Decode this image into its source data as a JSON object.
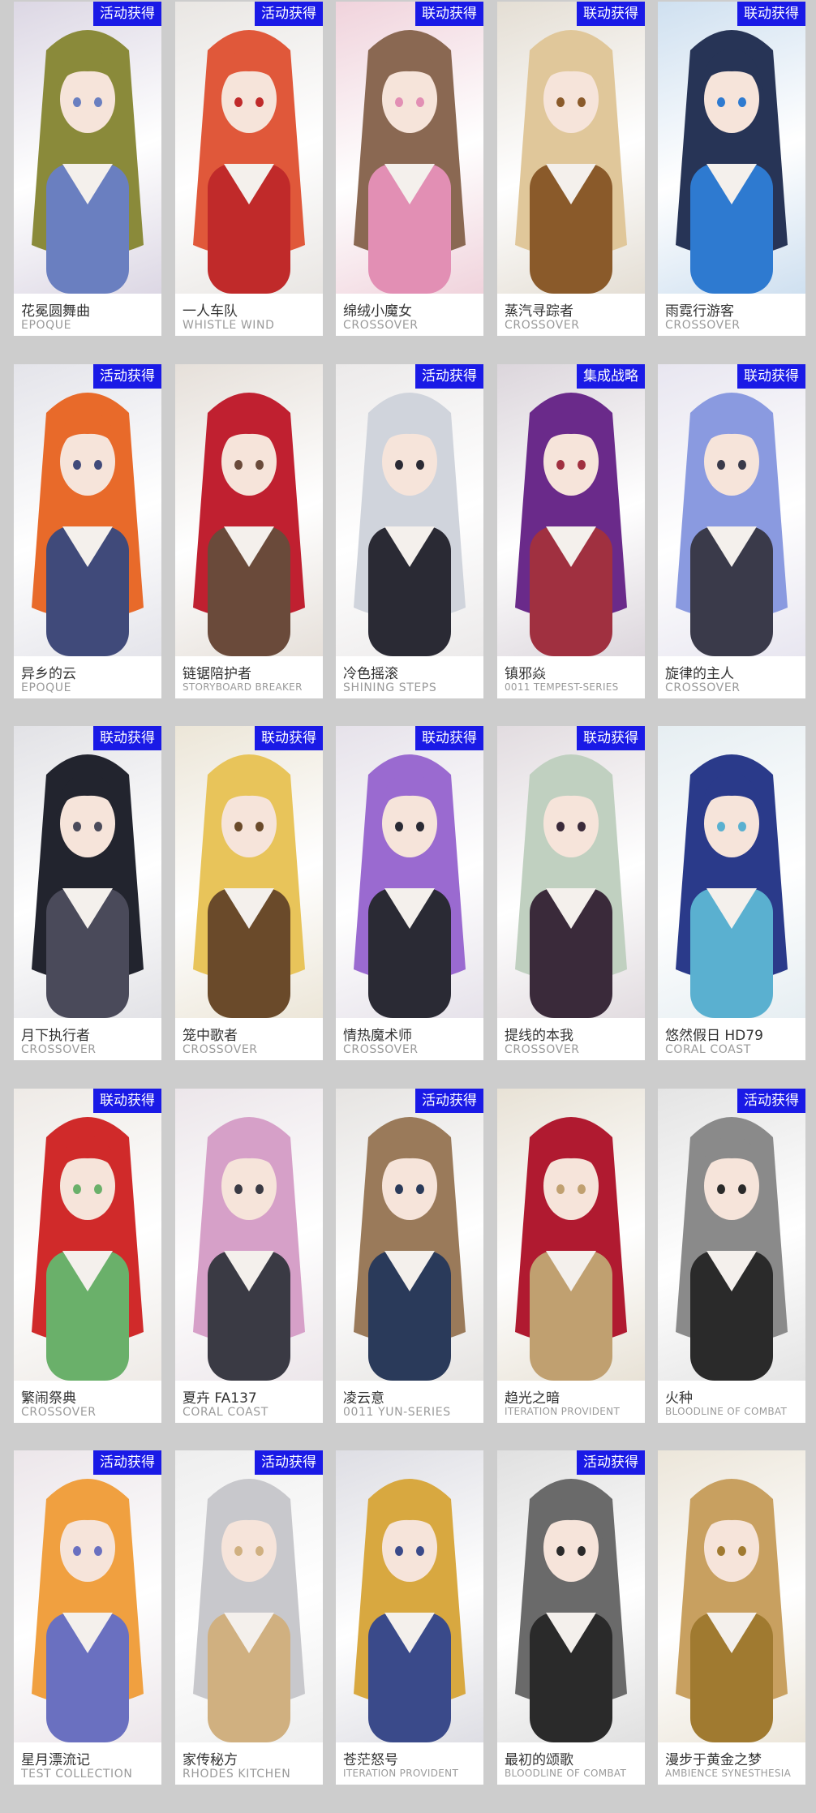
{
  "colors": {
    "page_background": "#cdcdcd",
    "card_background": "#ffffff",
    "badge_background": "#1a1ae6",
    "badge_text": "#ffffff",
    "name_text": "#333333",
    "series_text": "#9a9a9a"
  },
  "skins": [
    {
      "name": "花冕圆舞曲",
      "series": "EPOQUE",
      "badge": "活动获得",
      "hair": "#8a8a3a",
      "tone": "#dcd7e4",
      "accent": "#6a7fc0"
    },
    {
      "name": "一人车队",
      "series": "WHISTLE WIND",
      "badge": "活动获得",
      "hair": "#e0583a",
      "tone": "#e9e6e3",
      "accent": "#c02a2a"
    },
    {
      "name": "绵绒小魔女",
      "series": "CROSSOVER",
      "badge": "联动获得",
      "hair": "#8a6852",
      "tone": "#f0d3dc",
      "accent": "#e28fb4"
    },
    {
      "name": "蒸汽寻踪者",
      "series": "CROSSOVER",
      "badge": "联动获得",
      "hair": "#e0c79a",
      "tone": "#e4ded4",
      "accent": "#8a5a2a"
    },
    {
      "name": "雨霓行游客",
      "series": "CROSSOVER",
      "badge": "联动获得",
      "hair": "#273456",
      "tone": "#cfe0f0",
      "accent": "#2e7ad0"
    },
    {
      "name": "异乡的云",
      "series": "EPOQUE",
      "badge": "活动获得",
      "hair": "#e86a2a",
      "tone": "#e4e4ea",
      "accent": "#404a7a"
    },
    {
      "name": "链锯陪护者",
      "series": "STORYBOARD BREAKER",
      "badge": "",
      "hair": "#c02030",
      "tone": "#e6e0da",
      "accent": "#6a4a3a"
    },
    {
      "name": "冷色摇滚",
      "series": "SHINING STEPS",
      "badge": "活动获得",
      "hair": "#d0d4dc",
      "tone": "#eceaea",
      "accent": "#2a2a34"
    },
    {
      "name": "镇邪焱",
      "series": "0011 TEMPEST-SERIES",
      "badge": "集成战略",
      "hair": "#6a2a8a",
      "tone": "#dcd6dc",
      "accent": "#a03040"
    },
    {
      "name": "旋律的主人",
      "series": "CROSSOVER",
      "badge": "联动获得",
      "hair": "#8a9ae0",
      "tone": "#e8e6f0",
      "accent": "#3a3a4a"
    },
    {
      "name": "月下执行者",
      "series": "CROSSOVER",
      "badge": "联动获得",
      "hair": "#22242e",
      "tone": "#e2e2e6",
      "accent": "#4a4a5a"
    },
    {
      "name": "笼中歌者",
      "series": "CROSSOVER",
      "badge": "联动获得",
      "hair": "#e8c45a",
      "tone": "#ece6d8",
      "accent": "#6a4a2a"
    },
    {
      "name": "情热魔术师",
      "series": "CROSSOVER",
      "badge": "联动获得",
      "hair": "#9a6ad0",
      "tone": "#e6e2ea",
      "accent": "#2a2a34"
    },
    {
      "name": "提线的本我",
      "series": "CROSSOVER",
      "badge": "联动获得",
      "hair": "#c0d0c0",
      "tone": "#e2dce0",
      "accent": "#3a2a3a"
    },
    {
      "name": "悠然假日 HD79",
      "series": "CORAL COAST",
      "badge": "",
      "hair": "#2a3a8a",
      "tone": "#e6eef2",
      "accent": "#5ab0d0"
    },
    {
      "name": "繁闹祭典",
      "series": "CROSSOVER",
      "badge": "联动获得",
      "hair": "#d02a2a",
      "tone": "#eeeae6",
      "accent": "#6ab06a"
    },
    {
      "name": "夏卉 FA137",
      "series": "CORAL COAST",
      "badge": "",
      "hair": "#d6a0c8",
      "tone": "#ece6ea",
      "accent": "#3a3a44"
    },
    {
      "name": "凌云意",
      "series": "0011 YUN-SERIES",
      "badge": "活动获得",
      "hair": "#9a7a5a",
      "tone": "#e6e4e2",
      "accent": "#2a3a5a"
    },
    {
      "name": "趋光之暗",
      "series": "ITERATION PROVIDENT",
      "badge": "",
      "hair": "#b01a30",
      "tone": "#e8e2d6",
      "accent": "#c0a070"
    },
    {
      "name": "火种",
      "series": "BLOODLINE OF COMBAT",
      "badge": "活动获得",
      "hair": "#8a8a8a",
      "tone": "#e4e4e4",
      "accent": "#2a2a2a"
    },
    {
      "name": "星月漂流记",
      "series": "TEST COLLECTION",
      "badge": "活动获得",
      "hair": "#f0a040",
      "tone": "#ece6ea",
      "accent": "#6a70c0"
    },
    {
      "name": "家传秘方",
      "series": "RHODES KITCHEN",
      "badge": "活动获得",
      "hair": "#c8c8cc",
      "tone": "#eeeeee",
      "accent": "#d0b080"
    },
    {
      "name": "苍茫怒号",
      "series": "ITERATION PROVIDENT",
      "badge": "",
      "hair": "#d8a840",
      "tone": "#dedee4",
      "accent": "#3a4a8a"
    },
    {
      "name": "最初的颂歌",
      "series": "BLOODLINE OF COMBAT",
      "badge": "活动获得",
      "hair": "#6a6a6a",
      "tone": "#e0e0e0",
      "accent": "#2a2a2a"
    },
    {
      "name": "漫步于黄金之梦",
      "series": "AMBIENCE SYNESTHESIA",
      "badge": "",
      "hair": "#c8a060",
      "tone": "#ece6da",
      "accent": "#a07a30"
    }
  ]
}
